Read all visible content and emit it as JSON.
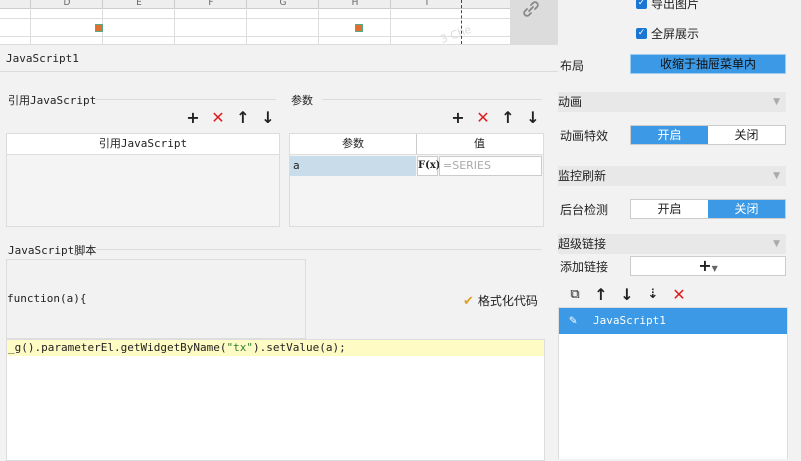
{
  "sheet": {
    "columns": [
      "D",
      "E",
      "F",
      "G",
      "H",
      "I"
    ],
    "watermark": "3 Che"
  },
  "dialog": {
    "title": "JavaScript1",
    "ref_section": {
      "title": "引用JavaScript",
      "column": "引用JavaScript"
    },
    "param_section": {
      "title": "参数",
      "columns": [
        "参数",
        "值"
      ],
      "rows": [
        {
          "name": "a",
          "value_placeholder": "=SERIES",
          "fx": "F(x)"
        }
      ]
    },
    "toolbar": {
      "add": "+",
      "delete": "✕",
      "up": "↑",
      "down": "↓"
    },
    "script_section": {
      "title": "JavaScript脚本",
      "function_header": "function(a){",
      "format_label": "格式化代码",
      "code": {
        "prefix": "_g().parameterEl.getWidgetByName(",
        "string": "\"tx\"",
        "suffix": ").setValue(a);"
      }
    }
  },
  "right_panel": {
    "export_image": "导出图片",
    "fullscreen": "全屏展示",
    "layout": {
      "label": "布局",
      "value": "收缩于抽屉菜单内"
    },
    "animation": {
      "title": "动画",
      "effect_label": "动画特效",
      "options": [
        "开启",
        "关闭"
      ],
      "selected": "开启"
    },
    "monitor": {
      "title": "监控刷新",
      "label": "后台检测",
      "options": [
        "开启",
        "关闭"
      ],
      "selected": "关闭"
    },
    "hyperlink": {
      "title": "超级链接",
      "add_label": "添加链接",
      "add_button": "+",
      "items": [
        "JavaScript1"
      ]
    }
  },
  "colors": {
    "accent": "#3b99e5",
    "delete": "#e02020",
    "code_highlight": "#fffbc4",
    "param_row": "#c8dce9"
  }
}
